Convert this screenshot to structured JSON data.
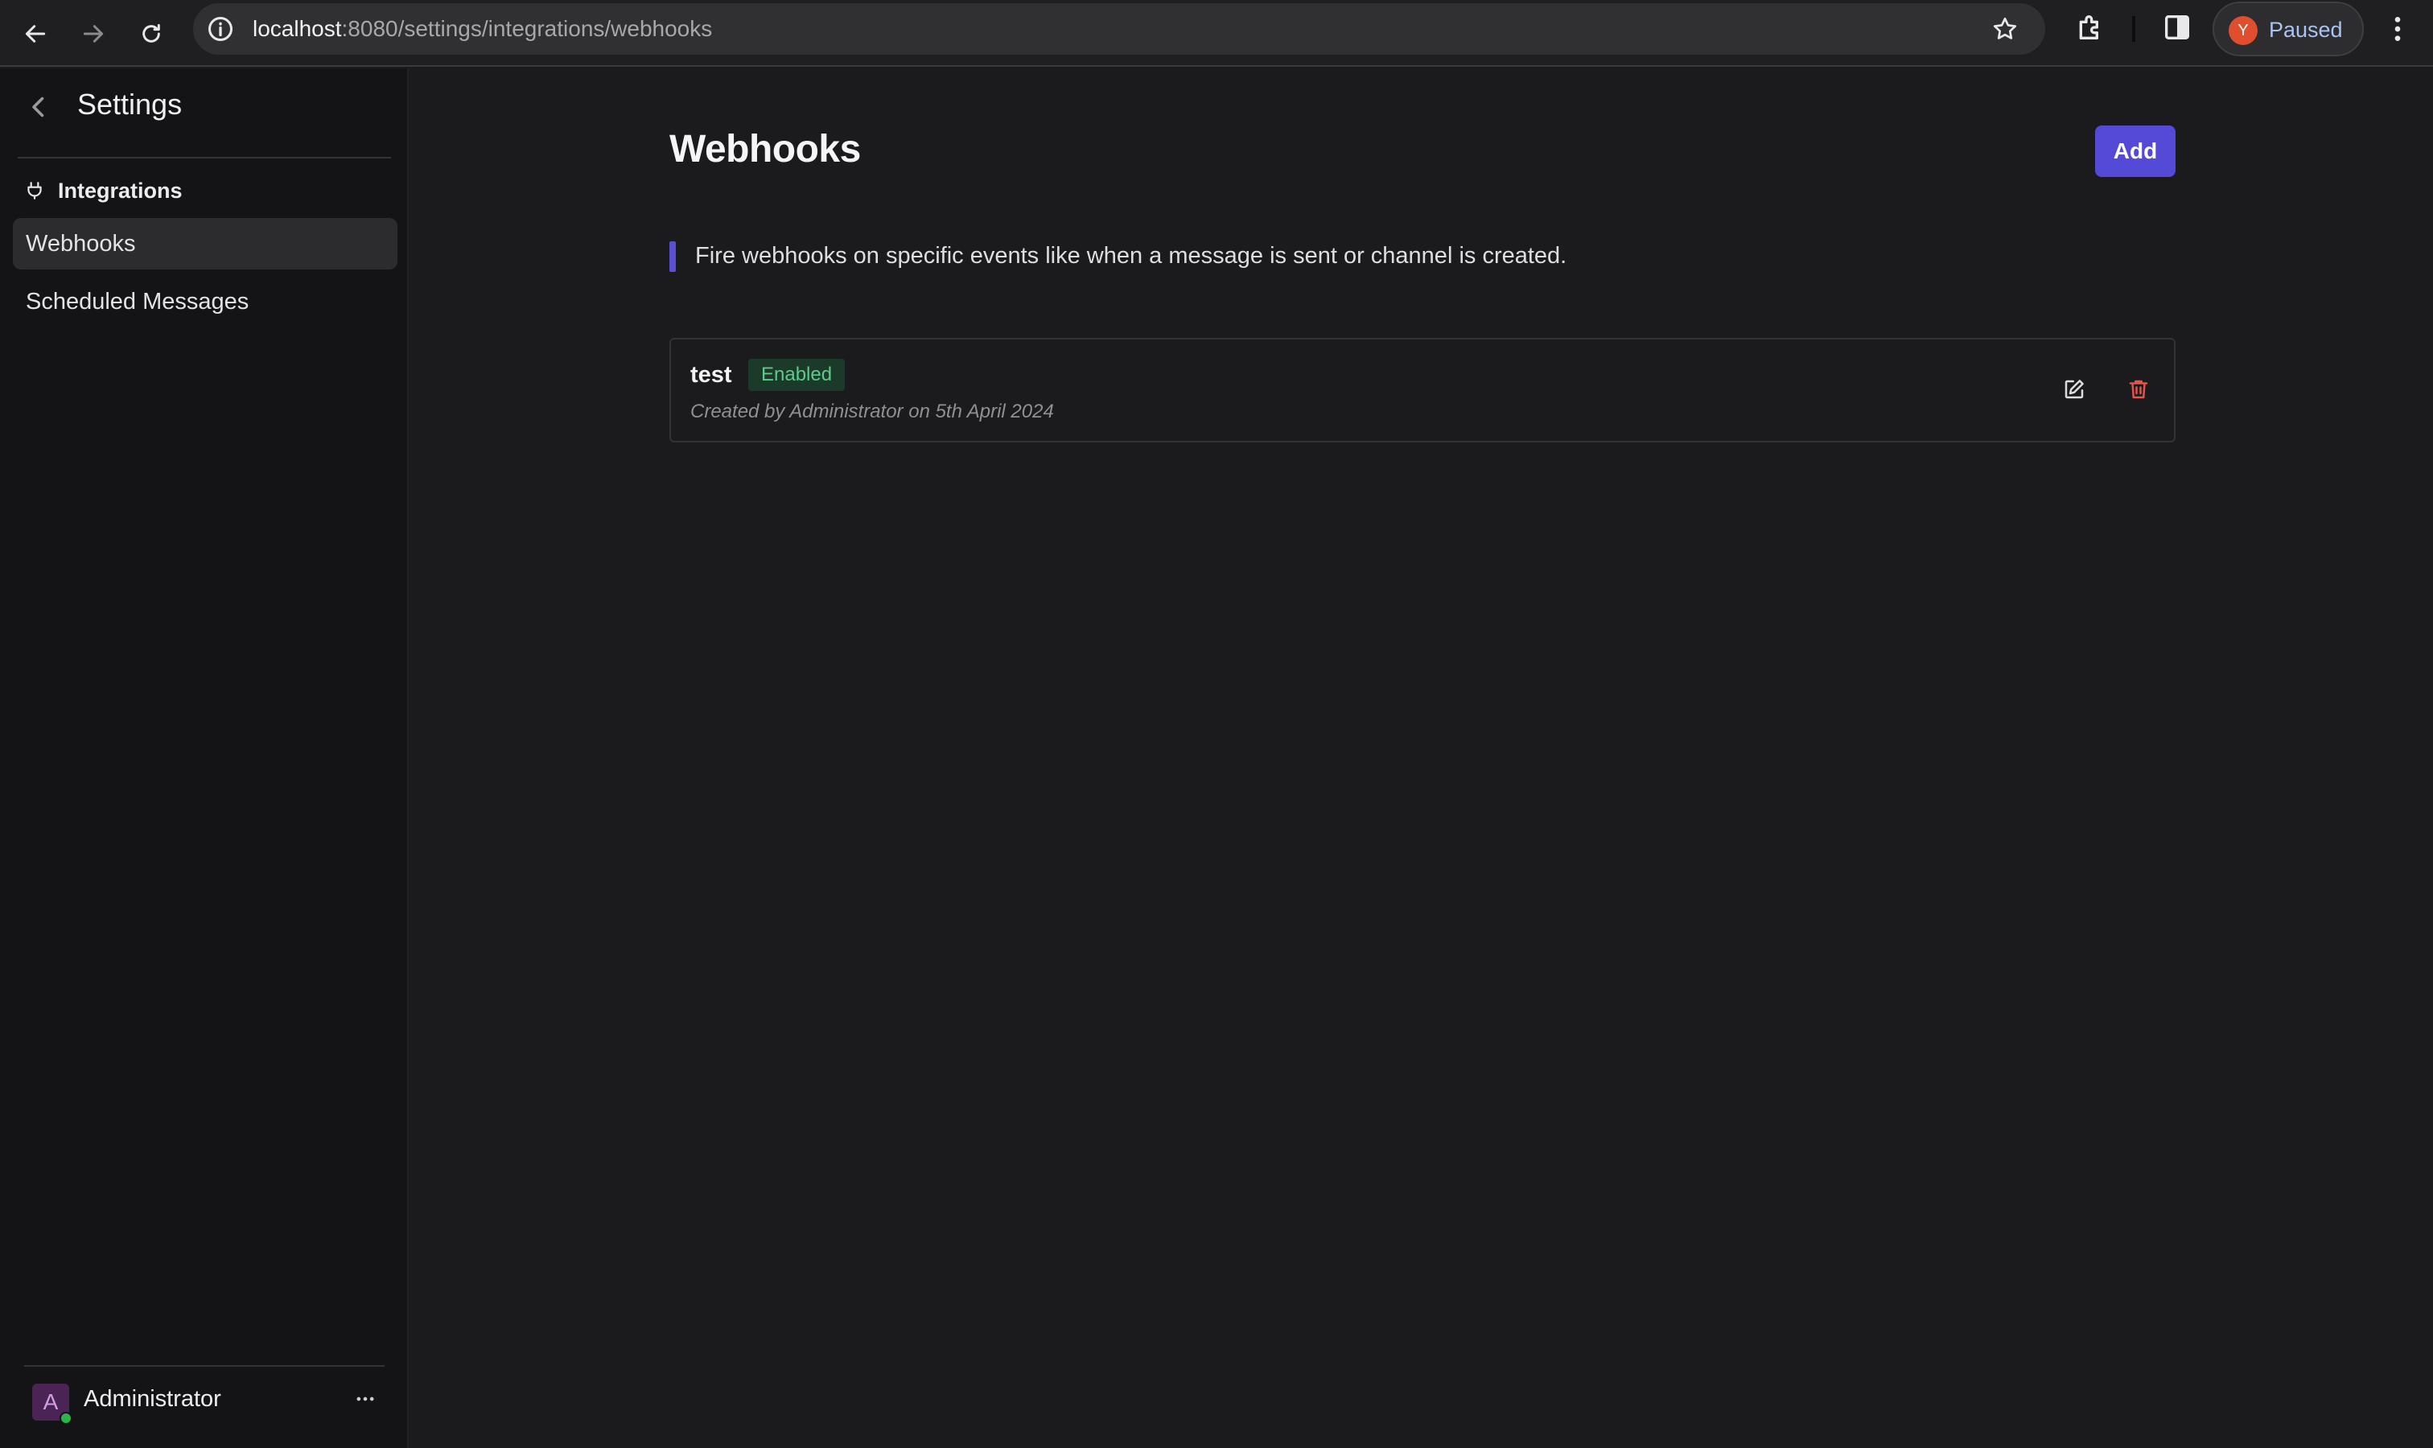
{
  "browser": {
    "url_host": "localhost",
    "url_path": ":8080/settings/integrations/webhooks",
    "profile_initial": "Y",
    "profile_status": "Paused"
  },
  "sidebar": {
    "title": "Settings",
    "group_label": "Integrations",
    "items": [
      {
        "label": "Webhooks",
        "active": true
      },
      {
        "label": "Scheduled Messages",
        "active": false
      }
    ],
    "user": {
      "initial": "A",
      "name": "Administrator"
    }
  },
  "main": {
    "title": "Webhooks",
    "add_label": "Add",
    "description": "Fire webhooks on specific events like when a message is sent or channel is created.",
    "webhooks": [
      {
        "name": "test",
        "status": "Enabled",
        "meta": "Created by Administrator on 5th April 2024"
      }
    ]
  },
  "colors": {
    "accent": "#5549d8",
    "enabled_text": "#5fc98a",
    "delete_icon": "#e5534b"
  },
  "icons": [
    "arrow-back-icon",
    "arrow-forward-icon",
    "reload-icon",
    "info-icon",
    "star-icon",
    "extensions-icon",
    "side-panel-icon",
    "kebab-menu-icon",
    "chevron-left-icon",
    "plug-icon",
    "ellipsis-icon",
    "edit-icon",
    "trash-icon"
  ]
}
